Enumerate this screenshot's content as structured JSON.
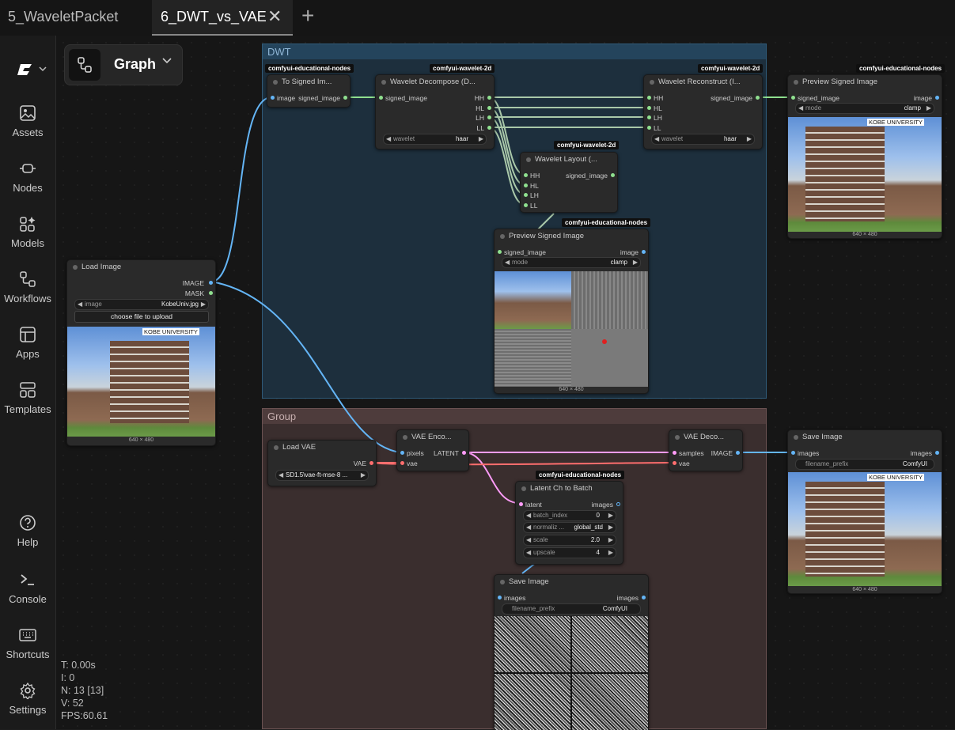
{
  "tabs": [
    {
      "label": "5_WaveletPacket"
    },
    {
      "label": "6_DWT_vs_VAE"
    }
  ],
  "graph_menu": {
    "label": "Graph"
  },
  "sidebar": {
    "items": [
      {
        "label": "Assets",
        "icon": "image-icon"
      },
      {
        "label": "Nodes",
        "icon": "nodes-icon"
      },
      {
        "label": "Models",
        "icon": "models-icon"
      },
      {
        "label": "Workflows",
        "icon": "workflows-icon"
      },
      {
        "label": "Apps",
        "icon": "apps-icon"
      },
      {
        "label": "Templates",
        "icon": "templates-icon"
      },
      {
        "label": "Help",
        "icon": "help-icon"
      },
      {
        "label": "Console",
        "icon": "console-icon"
      },
      {
        "label": "Shortcuts",
        "icon": "keyboard-icon"
      },
      {
        "label": "Settings",
        "icon": "gear-icon"
      }
    ]
  },
  "stats": {
    "t": "T: 0.00s",
    "i": "I: 0",
    "n": "N: 13 [13]",
    "v": "V: 52",
    "fps": "FPS:60.61"
  },
  "groups": {
    "dwt": "DWT",
    "group": "Group"
  },
  "colors": {
    "image": "#64b5f6",
    "signed": "#8fe08f",
    "vae": "#ff6e6e",
    "latent": "#ff9cf9",
    "dwt_group": "#1d2f3d",
    "group_bg": "#3a2e2e"
  },
  "nodes": {
    "load_image": {
      "title": "Load Image",
      "out1": "IMAGE",
      "out2": "MASK",
      "w_label": "image",
      "w_value": "KobeUniv.jpg",
      "upload": "choose file to upload",
      "size": "640 × 480",
      "logo": "KOBE UNIVERSITY"
    },
    "to_signed": {
      "badge": "comfyui-educational-nodes",
      "title": "To Signed Im...",
      "in": "image",
      "out": "signed_image"
    },
    "wavelet_decompose": {
      "badge": "comfyui-wavelet-2d",
      "title": "Wavelet Decompose (D...",
      "in": "signed_image",
      "outs": [
        "HH",
        "HL",
        "LH",
        "LL"
      ],
      "w_label": "wavelet",
      "w_value": "haar"
    },
    "wavelet_reconstruct": {
      "badge": "comfyui-wavelet-2d",
      "title": "Wavelet Reconstruct (I...",
      "ins": [
        "HH",
        "HL",
        "LH",
        "LL"
      ],
      "out": "signed_image",
      "w_label": "wavelet",
      "w_value": "haar"
    },
    "wavelet_layout": {
      "badge": "comfyui-wavelet-2d",
      "title": "Wavelet Layout (...",
      "ins": [
        "HH",
        "HL",
        "LH",
        "LL"
      ],
      "out": "signed_image"
    },
    "preview_signed_1": {
      "badge": "comfyui-educational-nodes",
      "title": "Preview Signed Image",
      "in": "signed_image",
      "out": "image",
      "w_label": "mode",
      "w_value": "clamp",
      "size": "640 × 480",
      "logo": "KOBE UNIVERSITY"
    },
    "preview_signed_2": {
      "badge": "comfyui-educational-nodes",
      "title": "Preview Signed Image",
      "in": "signed_image",
      "out": "image",
      "w_label": "mode",
      "w_value": "clamp",
      "size": "640 × 480"
    },
    "load_vae": {
      "title": "Load VAE",
      "out": "VAE",
      "w_value": "SD1.5\\vae-ft-mse-8 ..."
    },
    "vae_encode": {
      "title": "VAE Enco...",
      "in1": "pixels",
      "in2": "vae",
      "out": "LATENT"
    },
    "vae_decode": {
      "title": "VAE Deco...",
      "in1": "samples",
      "in2": "vae",
      "out": "IMAGE"
    },
    "latent_batch": {
      "badge": "comfyui-educational-nodes",
      "title": "Latent Ch to Batch",
      "in": "latent",
      "out": "images",
      "widgets": [
        {
          "label": "batch_index",
          "value": "0"
        },
        {
          "label": "normaliz ...",
          "value": "global_std"
        },
        {
          "label": "scale",
          "value": "2.0"
        },
        {
          "label": "upscale",
          "value": "4"
        }
      ]
    },
    "save_image_1": {
      "title": "Save Image",
      "in": "images",
      "out": "images",
      "w_label": "filename_prefix",
      "w_value": "ComfyUI",
      "size": "640 × 480",
      "logo": "KOBE UNIVERSITY"
    },
    "save_image_2": {
      "title": "Save Image",
      "in": "images",
      "out": "images",
      "w_label": "filename_prefix",
      "w_value": "ComfyUI"
    }
  }
}
